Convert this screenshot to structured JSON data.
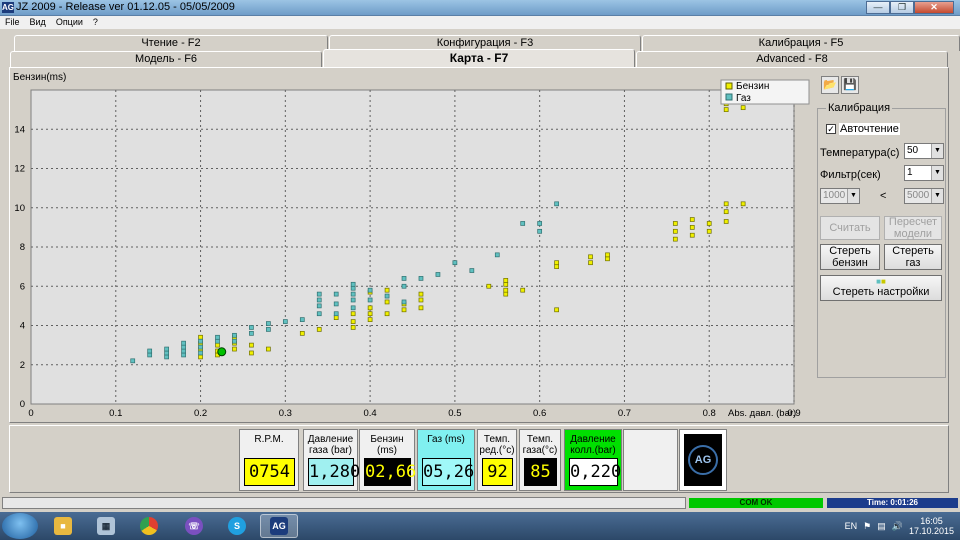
{
  "window": {
    "app_icon": "AG",
    "title": "JZ 2009 - Release  ver 01.12.05 - 05/05/2009",
    "buttons": [
      "minimize",
      "restore",
      "close"
    ]
  },
  "menu": [
    "File",
    "Вид",
    "Опции",
    "?"
  ],
  "tabs_top": [
    "Чтение - F2",
    "Конфигурация - F3",
    "Калибрация - F5"
  ],
  "tabs_bottom": [
    "Модель - F6",
    "Карта - F7",
    "Advanced - F8"
  ],
  "active_tab": "Карта - F7",
  "chart_data": {
    "type": "scatter",
    "ylabel": "Бензин(ms)",
    "xlabel": "Abs. давл. (bar)",
    "xlim": [
      0,
      0.9
    ],
    "ylim": [
      0,
      16
    ],
    "x_ticks": [
      "0",
      "0.1",
      "0.2",
      "0.3",
      "0.4",
      "0.5",
      "0.6",
      "0.7",
      "0.8",
      "0.9"
    ],
    "y_ticks": [
      "0",
      "2",
      "4",
      "6",
      "8",
      "10",
      "12",
      "14"
    ],
    "grid": true,
    "legend_position": "top-right",
    "series": [
      {
        "name": "Бензин",
        "color": "#f0f000",
        "points": [
          [
            0.2,
            2.4
          ],
          [
            0.2,
            2.8
          ],
          [
            0.2,
            3.1
          ],
          [
            0.2,
            3.4
          ],
          [
            0.22,
            2.5
          ],
          [
            0.22,
            2.7
          ],
          [
            0.22,
            3.0
          ],
          [
            0.24,
            2.8
          ],
          [
            0.24,
            3.1
          ],
          [
            0.24,
            3.4
          ],
          [
            0.26,
            2.6
          ],
          [
            0.26,
            3.0
          ],
          [
            0.28,
            2.8
          ],
          [
            0.32,
            3.6
          ],
          [
            0.34,
            3.8
          ],
          [
            0.36,
            4.4
          ],
          [
            0.38,
            3.9
          ],
          [
            0.38,
            4.2
          ],
          [
            0.38,
            4.6
          ],
          [
            0.4,
            4.3
          ],
          [
            0.4,
            4.6
          ],
          [
            0.4,
            4.9
          ],
          [
            0.4,
            5.7
          ],
          [
            0.42,
            4.6
          ],
          [
            0.42,
            5.2
          ],
          [
            0.42,
            5.8
          ],
          [
            0.44,
            4.8
          ],
          [
            0.44,
            5.1
          ],
          [
            0.46,
            4.9
          ],
          [
            0.46,
            5.3
          ],
          [
            0.46,
            5.6
          ],
          [
            0.54,
            6.0
          ],
          [
            0.56,
            5.6
          ],
          [
            0.56,
            5.8
          ],
          [
            0.56,
            6.1
          ],
          [
            0.56,
            6.3
          ],
          [
            0.58,
            5.8
          ],
          [
            0.62,
            4.8
          ],
          [
            0.62,
            7.0
          ],
          [
            0.62,
            7.2
          ],
          [
            0.66,
            7.2
          ],
          [
            0.66,
            7.5
          ],
          [
            0.68,
            7.4
          ],
          [
            0.68,
            7.6
          ],
          [
            0.76,
            8.4
          ],
          [
            0.76,
            8.8
          ],
          [
            0.76,
            9.2
          ],
          [
            0.78,
            8.6
          ],
          [
            0.78,
            9.0
          ],
          [
            0.78,
            9.4
          ],
          [
            0.8,
            8.8
          ],
          [
            0.8,
            9.2
          ],
          [
            0.82,
            9.3
          ],
          [
            0.82,
            9.8
          ],
          [
            0.82,
            10.2
          ],
          [
            0.82,
            15.0
          ],
          [
            0.82,
            15.3
          ],
          [
            0.84,
            10.2
          ],
          [
            0.84,
            15.1
          ]
        ]
      },
      {
        "name": "Газ",
        "color": "#60c0c0",
        "points": [
          [
            0.12,
            2.2
          ],
          [
            0.14,
            2.5
          ],
          [
            0.14,
            2.7
          ],
          [
            0.16,
            2.4
          ],
          [
            0.16,
            2.6
          ],
          [
            0.16,
            2.8
          ],
          [
            0.18,
            2.5
          ],
          [
            0.18,
            2.7
          ],
          [
            0.18,
            2.9
          ],
          [
            0.18,
            3.1
          ],
          [
            0.2,
            2.6
          ],
          [
            0.2,
            2.9
          ],
          [
            0.2,
            3.2
          ],
          [
            0.22,
            3.2
          ],
          [
            0.22,
            3.4
          ],
          [
            0.24,
            3.2
          ],
          [
            0.24,
            3.5
          ],
          [
            0.26,
            3.6
          ],
          [
            0.26,
            3.9
          ],
          [
            0.28,
            3.8
          ],
          [
            0.28,
            4.1
          ],
          [
            0.3,
            4.2
          ],
          [
            0.32,
            4.3
          ],
          [
            0.34,
            4.6
          ],
          [
            0.34,
            5.0
          ],
          [
            0.34,
            5.3
          ],
          [
            0.34,
            5.6
          ],
          [
            0.36,
            4.6
          ],
          [
            0.36,
            5.1
          ],
          [
            0.36,
            5.6
          ],
          [
            0.38,
            4.9
          ],
          [
            0.38,
            5.3
          ],
          [
            0.38,
            5.6
          ],
          [
            0.38,
            5.9
          ],
          [
            0.38,
            6.1
          ],
          [
            0.4,
            5.3
          ],
          [
            0.4,
            5.8
          ],
          [
            0.42,
            5.5
          ],
          [
            0.44,
            5.2
          ],
          [
            0.44,
            6.0
          ],
          [
            0.44,
            6.4
          ],
          [
            0.46,
            6.4
          ],
          [
            0.48,
            6.6
          ],
          [
            0.5,
            7.2
          ],
          [
            0.52,
            6.8
          ],
          [
            0.55,
            7.6
          ],
          [
            0.58,
            9.2
          ],
          [
            0.6,
            8.8
          ],
          [
            0.6,
            9.2
          ],
          [
            0.62,
            10.2
          ]
        ]
      }
    ],
    "current_point": {
      "x": 0.225,
      "y": 2.66,
      "color": "#00c000"
    }
  },
  "right_panel": {
    "icons": [
      "open-folder-icon",
      "save-icon"
    ],
    "group_title": "Калибрация",
    "autoread_label": "Авточтение",
    "autoread_checked": true,
    "temp_label": "Температура(c)",
    "temp_value": "50",
    "filter_label": "Фильтр(сек)",
    "filter_value": "1",
    "range_min": "1000",
    "range_sep": "<",
    "range_max": "5000",
    "btn_count": "Считать",
    "btn_recalc": "Пересчет модели",
    "btn_clear_petrol": "Стереть бензин",
    "btn_clear_gas": "Стереть газ",
    "btn_clear_settings": "Стереть настройки"
  },
  "gauges": [
    {
      "label": "R.P.M.",
      "value": "0754",
      "bg": "#f0f0f0",
      "value_bg": "#ffff00",
      "value_color": "#000000"
    },
    {
      "label": "Давление газа (bar)",
      "value": "1,280",
      "bg": "#f0f0f0",
      "value_bg": "#a0f0f0",
      "value_color": "#000000"
    },
    {
      "label": "Бензин (ms)",
      "value": "02,66",
      "bg": "#f0f0f0",
      "value_bg": "#000000",
      "value_color": "#ffff00"
    },
    {
      "label": "Газ (ms)",
      "value": "05,26",
      "bg": "#80f0f0",
      "value_bg": "#a0f8f8",
      "value_color": "#000000"
    },
    {
      "label": "Темп. ред.(°c)",
      "value": "92",
      "bg": "#f0f0f0",
      "value_bg": "#ffff00",
      "value_color": "#000000"
    },
    {
      "label": "Темп. газа(°c)",
      "value": "85",
      "bg": "#f0f0f0",
      "value_bg": "#000000",
      "value_color": "#ffff00"
    },
    {
      "label": "Давление колл.(bar)",
      "value": "0,220",
      "bg": "#00e000",
      "value_bg": "#ffffff",
      "value_color": "#000000"
    }
  ],
  "logo_text": "AG",
  "status": {
    "com": "COM OK",
    "time": "Time: 0:01:26"
  },
  "taskbar": {
    "apps": [
      "explorer-icon",
      "calculator-icon",
      "chrome-icon",
      "viber-icon",
      "skype-icon",
      "ag-app-icon"
    ],
    "active_app_label": "AG",
    "lang": "EN",
    "time": "16:05",
    "date": "17.10.2015"
  }
}
